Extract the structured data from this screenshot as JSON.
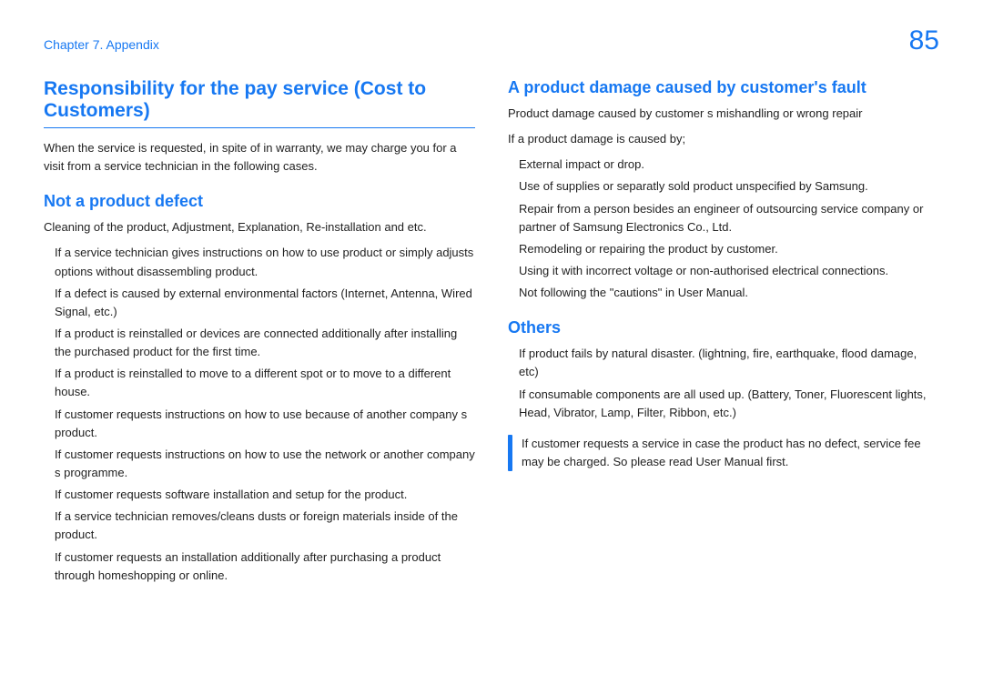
{
  "header": {
    "chapter": "Chapter 7. Appendix",
    "page": "85"
  },
  "left": {
    "title": "Responsibility for the pay service (Cost to Customers)",
    "intro": "When the service is requested, in spite of in warranty, we may charge you for a visit from a service technician in the following cases.",
    "section1": {
      "heading": "Not a product defect",
      "lead": "Cleaning of the product, Adjustment, Explanation, Re-installation and etc.",
      "items": [
        "If a service technician gives instructions on how to use product or simply adjusts options without disassembling product.",
        "If a defect is caused by external environmental factors (Internet, Antenna, Wired Signal, etc.)",
        "If a product is reinstalled or devices are connected additionally after installing the purchased product for the first time.",
        "If a product is reinstalled to move to a different spot or to move to a different house.",
        "If customer requests instructions on how to use because of another company s product.",
        "If customer requests instructions on how to use the network or another company s programme.",
        "If customer requests software installation and setup for the product.",
        "If a service technician removes/cleans dusts or foreign materials inside of the product.",
        "If customer requests an installation additionally after purchasing a product through homeshopping or online."
      ]
    }
  },
  "right": {
    "section2": {
      "heading": "A product damage caused by customer's fault",
      "lead1": "Product damage caused by customer s mishandling or wrong repair",
      "lead2": "If a product damage is caused by;",
      "items": [
        "External impact or drop.",
        "Use of supplies or separatly sold product unspecified by Samsung.",
        "Repair from a person besides an engineer of outsourcing service company or partner of Samsung Electronics Co., Ltd.",
        "Remodeling or repairing the product by customer.",
        "Using it with incorrect voltage or non-authorised electrical connections.",
        "Not following the \"cautions\" in User Manual."
      ]
    },
    "section3": {
      "heading": "Others",
      "items": [
        "If product fails by natural disaster. (lightning, fire, earthquake, flood damage, etc)",
        "If consumable components are all used up. (Battery, Toner, Fluorescent lights, Head, Vibrator, Lamp, Filter, Ribbon, etc.)"
      ],
      "note": "If customer requests a service in case the product has no defect, service fee may be charged. So please read User Manual first."
    }
  }
}
